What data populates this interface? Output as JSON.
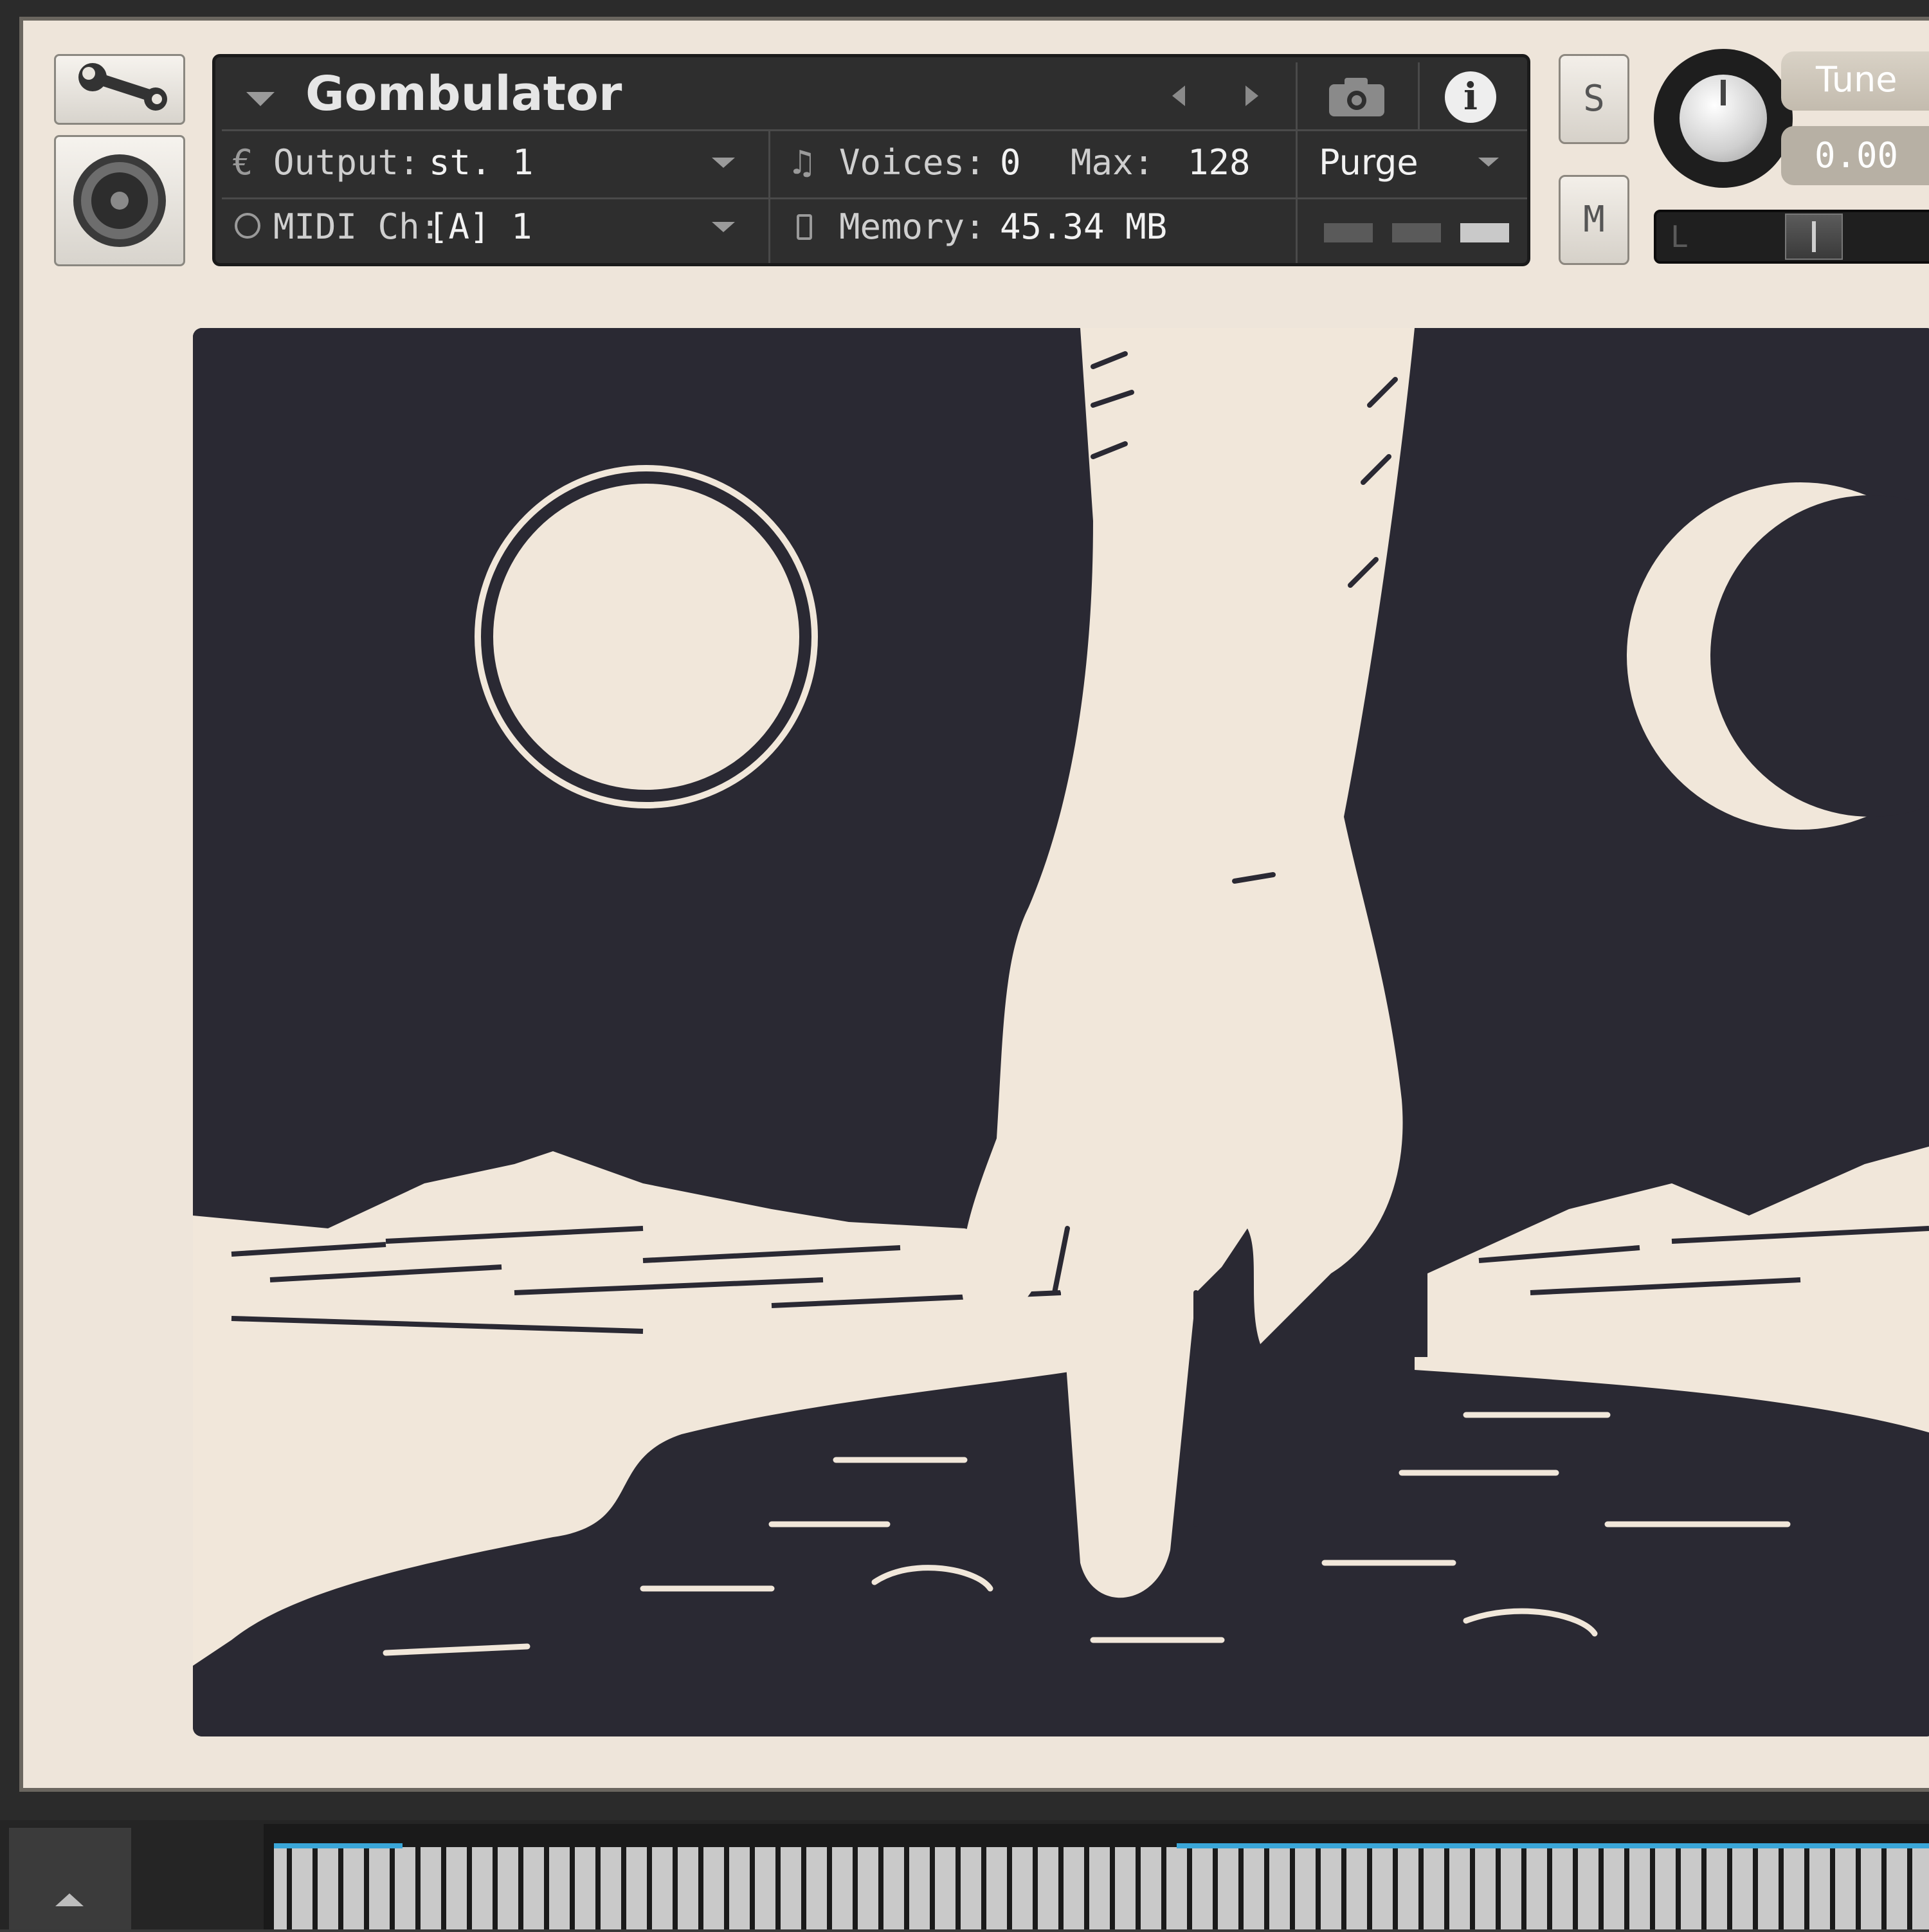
{
  "header": {
    "instrument_name": "Gombulator",
    "output_label": "Output:",
    "output_value": "st. 1",
    "midi_label": "MIDI Ch:",
    "midi_value": "[A]  1",
    "voices_label": "Voices:",
    "voices_value": "0",
    "max_label": "Max:",
    "max_value": "128",
    "memory_label": "Memory:",
    "memory_value": "45.34 MB",
    "purge_label": "Purge",
    "info_symbol": "i"
  },
  "solo_label": "S",
  "mute_label": "M",
  "tune": {
    "label": "Tune",
    "value": "0.00"
  },
  "pan": {
    "left_label": "L"
  },
  "colors": {
    "panel_bg": "#eee5da",
    "header_bg": "#2e2e2e",
    "artwork_ink": "#2a2933",
    "artwork_paper": "#f1e7da",
    "keyboard_accent": "#3aa6d8"
  }
}
